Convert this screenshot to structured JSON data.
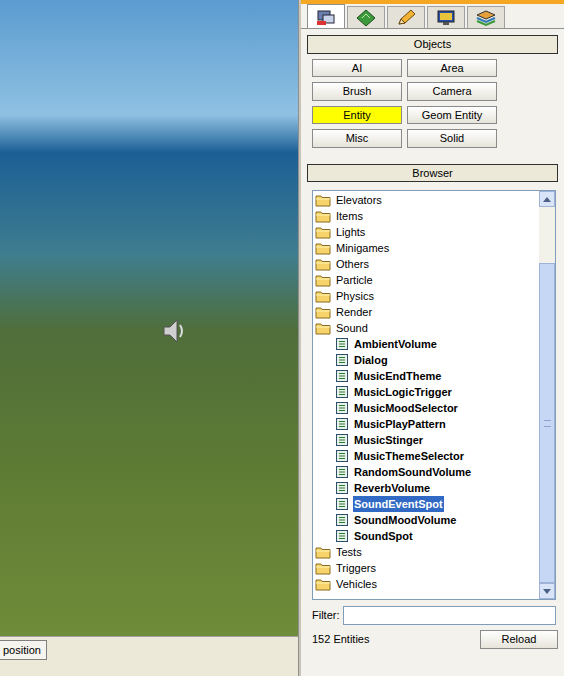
{
  "viewport": {
    "button": "position"
  },
  "tabs": [
    {
      "icon": "create",
      "selected": true
    },
    {
      "icon": "terrain",
      "selected": false
    },
    {
      "icon": "modify",
      "selected": false
    },
    {
      "icon": "display",
      "selected": false
    },
    {
      "icon": "layers",
      "selected": false
    }
  ],
  "objects": {
    "header": "Objects",
    "buttons": [
      {
        "label": "AI",
        "selected": false
      },
      {
        "label": "Area",
        "selected": false
      },
      {
        "label": "Brush",
        "selected": false
      },
      {
        "label": "Camera",
        "selected": false
      },
      {
        "label": "Entity",
        "selected": true
      },
      {
        "label": "Geom Entity",
        "selected": false
      },
      {
        "label": "Misc",
        "selected": false
      },
      {
        "label": "Solid",
        "selected": false
      }
    ]
  },
  "browser": {
    "header": "Browser",
    "items": [
      {
        "label": "Elevators",
        "kind": "folder",
        "expanded": false,
        "selected": false
      },
      {
        "label": "Items",
        "kind": "folder",
        "expanded": false,
        "selected": false
      },
      {
        "label": "Lights",
        "kind": "folder",
        "expanded": false,
        "selected": false
      },
      {
        "label": "Minigames",
        "kind": "folder",
        "expanded": false,
        "selected": false
      },
      {
        "label": "Others",
        "kind": "folder",
        "expanded": false,
        "selected": false
      },
      {
        "label": "Particle",
        "kind": "folder",
        "expanded": false,
        "selected": false
      },
      {
        "label": "Physics",
        "kind": "folder",
        "expanded": false,
        "selected": false
      },
      {
        "label": "Render",
        "kind": "folder",
        "expanded": false,
        "selected": false
      },
      {
        "label": "Sound",
        "kind": "folder",
        "expanded": true,
        "selected": false
      },
      {
        "label": "AmbientVolume",
        "kind": "entity",
        "expanded": false,
        "selected": false
      },
      {
        "label": "Dialog",
        "kind": "entity",
        "expanded": false,
        "selected": false
      },
      {
        "label": "MusicEndTheme",
        "kind": "entity",
        "expanded": false,
        "selected": false
      },
      {
        "label": "MusicLogicTrigger",
        "kind": "entity",
        "expanded": false,
        "selected": false
      },
      {
        "label": "MusicMoodSelector",
        "kind": "entity",
        "expanded": false,
        "selected": false
      },
      {
        "label": "MusicPlayPattern",
        "kind": "entity",
        "expanded": false,
        "selected": false
      },
      {
        "label": "MusicStinger",
        "kind": "entity",
        "expanded": false,
        "selected": false
      },
      {
        "label": "MusicThemeSelector",
        "kind": "entity",
        "expanded": false,
        "selected": false
      },
      {
        "label": "RandomSoundVolume",
        "kind": "entity",
        "expanded": false,
        "selected": false
      },
      {
        "label": "ReverbVolume",
        "kind": "entity",
        "expanded": false,
        "selected": false
      },
      {
        "label": "SoundEventSpot",
        "kind": "entity",
        "expanded": false,
        "selected": true
      },
      {
        "label": "SoundMoodVolume",
        "kind": "entity",
        "expanded": false,
        "selected": false
      },
      {
        "label": "SoundSpot",
        "kind": "entity",
        "expanded": false,
        "selected": false
      },
      {
        "label": "Tests",
        "kind": "folder",
        "expanded": false,
        "selected": false
      },
      {
        "label": "Triggers",
        "kind": "folder",
        "expanded": false,
        "selected": false
      },
      {
        "label": "Vehicles",
        "kind": "folder",
        "expanded": false,
        "selected": false
      }
    ],
    "scrollbar": {
      "start": 0.15,
      "size": 0.85
    },
    "filter": {
      "label": "Filter:",
      "value": ""
    },
    "count": "152 Entities",
    "reload": "Reload"
  }
}
